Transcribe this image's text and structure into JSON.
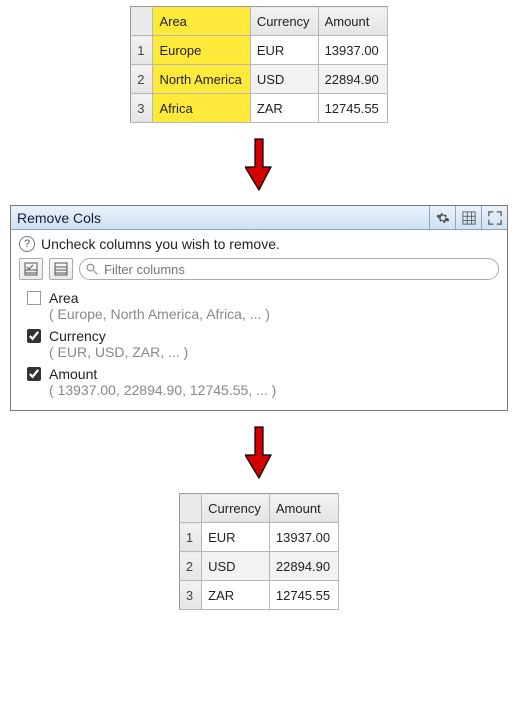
{
  "table_before": {
    "highlight_column_index": 0,
    "columns": [
      "Area",
      "Currency",
      "Amount"
    ],
    "rows": [
      {
        "n": "1",
        "cells": [
          "Europe",
          "EUR",
          "13937.00"
        ]
      },
      {
        "n": "2",
        "cells": [
          "North America",
          "USD",
          "22894.90"
        ]
      },
      {
        "n": "3",
        "cells": [
          "Africa",
          "ZAR",
          "12745.55"
        ]
      }
    ]
  },
  "panel": {
    "title": "Remove Cols",
    "instruction": "Uncheck columns you wish to remove.",
    "filter_placeholder": "Filter columns",
    "items": [
      {
        "name": "Area",
        "preview": "( Europe, North America, Africa, ... )",
        "checked": false
      },
      {
        "name": "Currency",
        "preview": "( EUR, USD, ZAR, ... )",
        "checked": true
      },
      {
        "name": "Amount",
        "preview": "( 13937.00, 22894.90, 12745.55, ... )",
        "checked": true
      }
    ]
  },
  "table_after": {
    "columns": [
      "Currency",
      "Amount"
    ],
    "rows": [
      {
        "n": "1",
        "cells": [
          "EUR",
          "13937.00"
        ]
      },
      {
        "n": "2",
        "cells": [
          "USD",
          "22894.90"
        ]
      },
      {
        "n": "3",
        "cells": [
          "ZAR",
          "12745.55"
        ]
      }
    ]
  }
}
